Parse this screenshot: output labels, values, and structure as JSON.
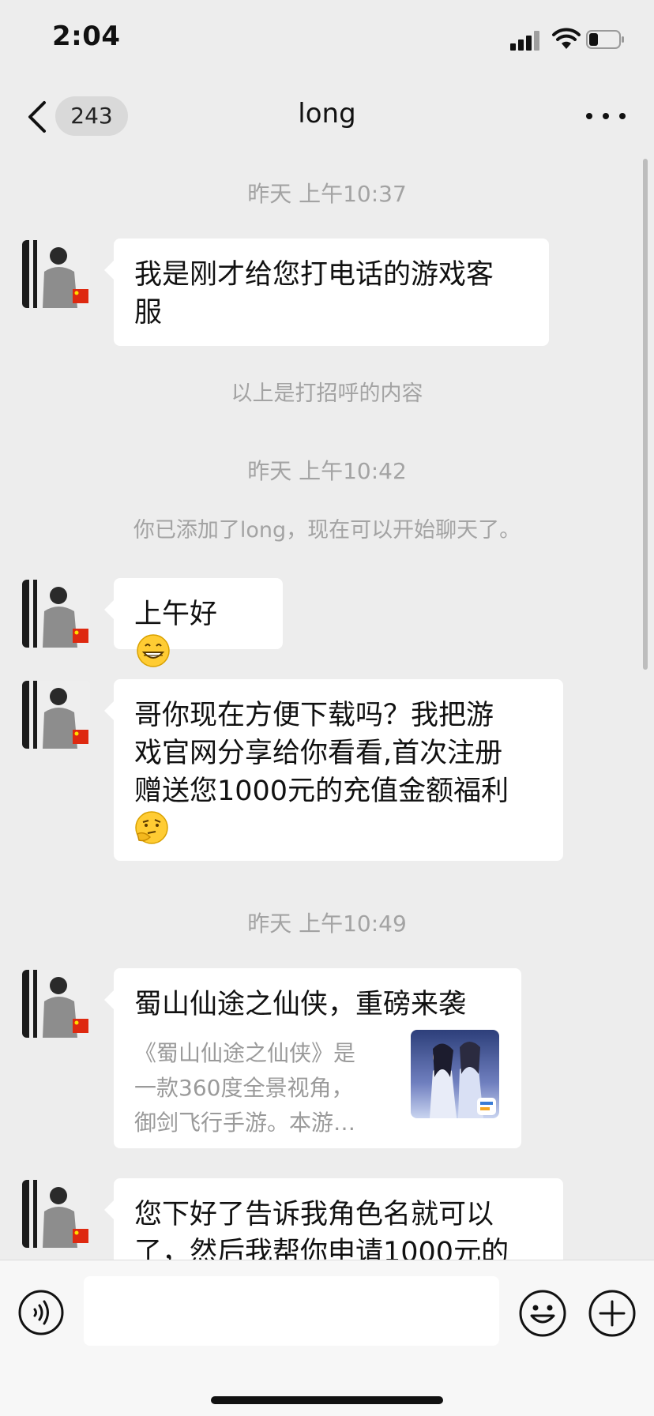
{
  "status_bar": {
    "time": "2:04"
  },
  "nav": {
    "back_count": "243",
    "title": "long"
  },
  "chat": {
    "timestamps": [
      "昨天 上午10:37",
      "昨天 上午10:42",
      "昨天 上午10:49"
    ],
    "system_messages": [
      "以上是打招呼的内容",
      "你已添加了long，现在可以开始聊天了。"
    ],
    "messages": [
      {
        "line1": "我是刚才给您打电话的游戏客",
        "line2": "服"
      },
      {
        "text": "上午好",
        "emoji": "grin-emoji"
      },
      {
        "line1": "哥你现在方便下载吗？我把游",
        "line2": "戏官网分享给你看看,首次注册",
        "line3": "赠送您1000元的充值金额福利",
        "emoji": "thinking-emoji"
      },
      {
        "title": "蜀山仙途之仙侠，重磅来袭",
        "desc1": "《蜀山仙途之仙侠》是",
        "desc2": "一款360度全景视角，",
        "desc3": "御剑飞行手游。本游…"
      },
      {
        "line1": "您下好了告诉我角色名就可以",
        "line2": "了，然后我帮你申请1000元的"
      }
    ]
  },
  "input_bar": {
    "placeholder": ""
  },
  "colors": {
    "background": "#ededed",
    "bubble": "#ffffff",
    "meta_text": "#a3a3a3",
    "badge_bg": "#d9d9d9"
  }
}
